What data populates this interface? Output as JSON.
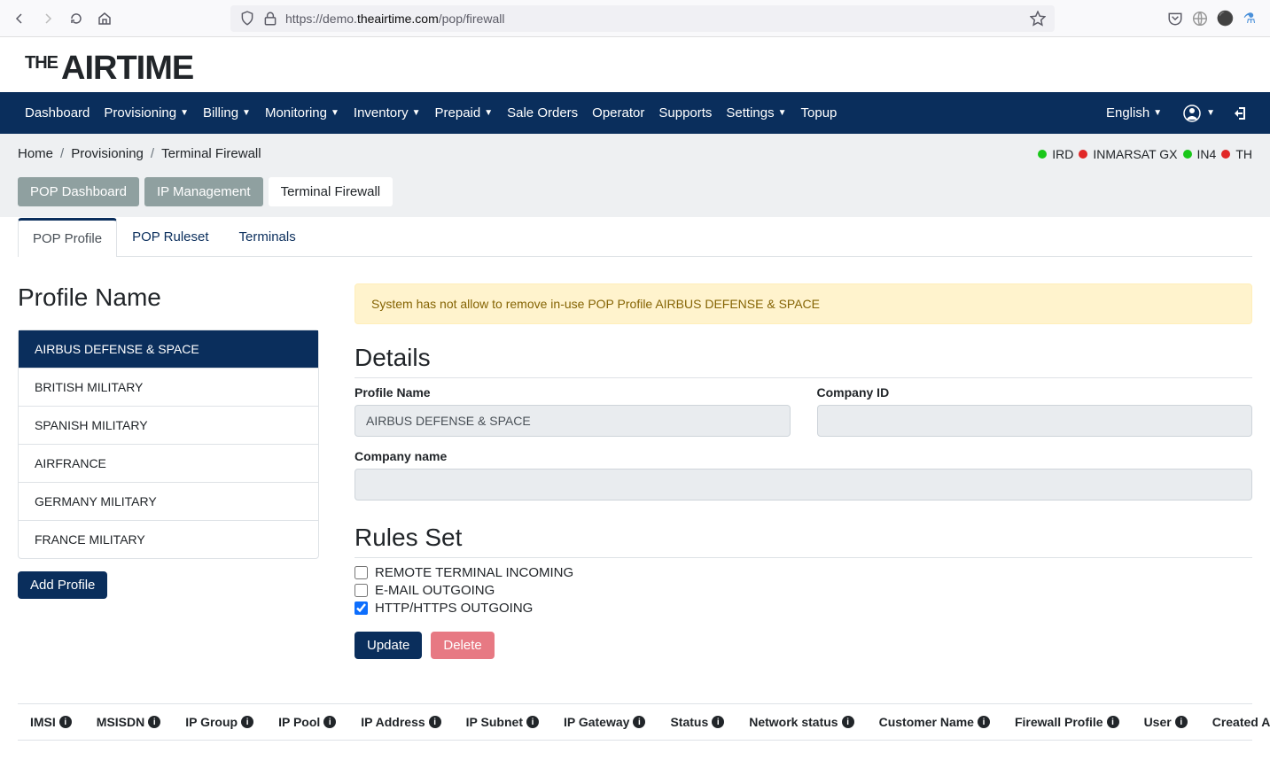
{
  "browser": {
    "url_prefix": "https://demo.",
    "url_domain": "theairtime.com",
    "url_path": "/pop/firewall"
  },
  "nav": {
    "items": [
      "Dashboard",
      "Provisioning",
      "Billing",
      "Monitoring",
      "Inventory",
      "Prepaid",
      "Sale Orders",
      "Operator",
      "Supports",
      "Settings",
      "Topup"
    ],
    "dropdowns": [
      false,
      true,
      true,
      true,
      true,
      true,
      false,
      false,
      false,
      true,
      false
    ],
    "language": "English"
  },
  "breadcrumb": [
    "Home",
    "Provisioning",
    "Terminal Firewall"
  ],
  "status": [
    {
      "label": "IRD",
      "color": "green"
    },
    {
      "label": "INMARSAT GX",
      "color": "red"
    },
    {
      "label": "IN4",
      "color": "green"
    },
    {
      "label": "TH",
      "color": "red"
    }
  ],
  "sec_tabs": {
    "items": [
      "POP Dashboard",
      "IP Management",
      "Terminal Firewall"
    ],
    "active": 2
  },
  "inner_tabs": {
    "items": [
      "POP Profile",
      "POP Ruleset",
      "Terminals"
    ],
    "active": 0
  },
  "left": {
    "title": "Profile Name",
    "profiles": [
      "AIRBUS DEFENSE & SPACE",
      "BRITISH MILITARY",
      "SPANISH MILITARY",
      "AIRFRANCE",
      "GERMANY MILITARY",
      "FRANCE MILITARY"
    ],
    "active": 0,
    "add_button": "Add Profile"
  },
  "alert": "System has not allow to remove in-use POP Profile AIRBUS DEFENSE & SPACE",
  "details": {
    "title": "Details",
    "profile_name_label": "Profile Name",
    "profile_name_value": "AIRBUS DEFENSE & SPACE",
    "company_id_label": "Company ID",
    "company_id_value": "",
    "company_name_label": "Company name",
    "company_name_value": ""
  },
  "rules": {
    "title": "Rules Set",
    "items": [
      {
        "label": "REMOTE TERMINAL INCOMING",
        "checked": false
      },
      {
        "label": "E-MAIL OUTGOING",
        "checked": false
      },
      {
        "label": "HTTP/HTTPS OUTGOING",
        "checked": true
      }
    ],
    "update": "Update",
    "delete": "Delete"
  },
  "table_headers": [
    "IMSI",
    "MSISDN",
    "IP Group",
    "IP Pool",
    "IP Address",
    "IP Subnet",
    "IP Gateway",
    "Status",
    "Network status",
    "Customer Name",
    "Firewall Profile",
    "User",
    "Created At"
  ]
}
